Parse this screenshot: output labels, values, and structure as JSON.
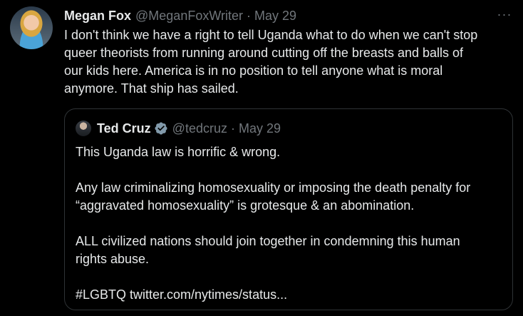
{
  "tweet": {
    "author": {
      "display_name": "Megan Fox",
      "handle": "@MeganFoxWriter",
      "separator": "·",
      "date": "May 29"
    },
    "more_icon": "ellipsis-horizontal-icon",
    "more_glyph": "···",
    "text_lines": [
      "I don't think we have a right to tell Uganda what to do when we can't stop",
      "queer theorists from running around cutting off the breasts and balls of",
      "our kids here. America is in no position to tell anyone what is moral",
      "anymore. That ship has sailed."
    ]
  },
  "quoted_tweet": {
    "author": {
      "display_name": "Ted Cruz",
      "handle": "@tedcruz",
      "separator": "·",
      "date": "May 29",
      "verified_icon": "verified-badge-icon"
    },
    "paragraphs": [
      [
        "This Uganda law is horrific & wrong."
      ],
      [
        "Any law criminalizing homosexuality or imposing the death penalty for",
        "“aggravated homosexuality” is grotesque & an abomination."
      ],
      [
        "ALL civilized nations should join together in condemning this human",
        "rights abuse."
      ],
      [
        "#LGBTQ twitter.com/nytimes/status..."
      ]
    ]
  },
  "colors": {
    "background": "#000000",
    "primary_text": "#e7e9ea",
    "secondary_text": "#71767b",
    "border": "#2f3336",
    "verified_badge": "#829aab"
  }
}
